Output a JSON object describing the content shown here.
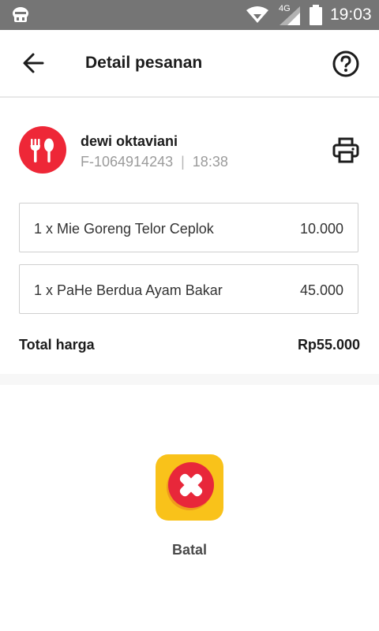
{
  "status_bar": {
    "network_type": "4G",
    "time": "19:03"
  },
  "header": {
    "title": "Detail pesanan"
  },
  "order": {
    "customer_name": "dewi oktaviani",
    "order_id": "F-1064914243",
    "separator": "|",
    "order_time": "18:38",
    "items": [
      {
        "name": "1 x Mie Goreng Telor Ceplok",
        "price": "10.000"
      },
      {
        "name": "1 x PaHe Berdua Ayam Bakar",
        "price": "45.000"
      }
    ],
    "total_label": "Total harga",
    "total_value": "Rp55.000"
  },
  "status": {
    "label": "Batal"
  },
  "icons": {
    "back": "arrow-left-icon",
    "help": "help-circle-icon",
    "print": "printer-icon",
    "avatar": "fork-spoon-icon",
    "cancel": "cancel-x-icon"
  },
  "colors": {
    "status_bar": "#757575",
    "avatar_red": "#ee2737",
    "cancel_yellow": "#f9c21a",
    "cancel_red": "#e8273a"
  }
}
